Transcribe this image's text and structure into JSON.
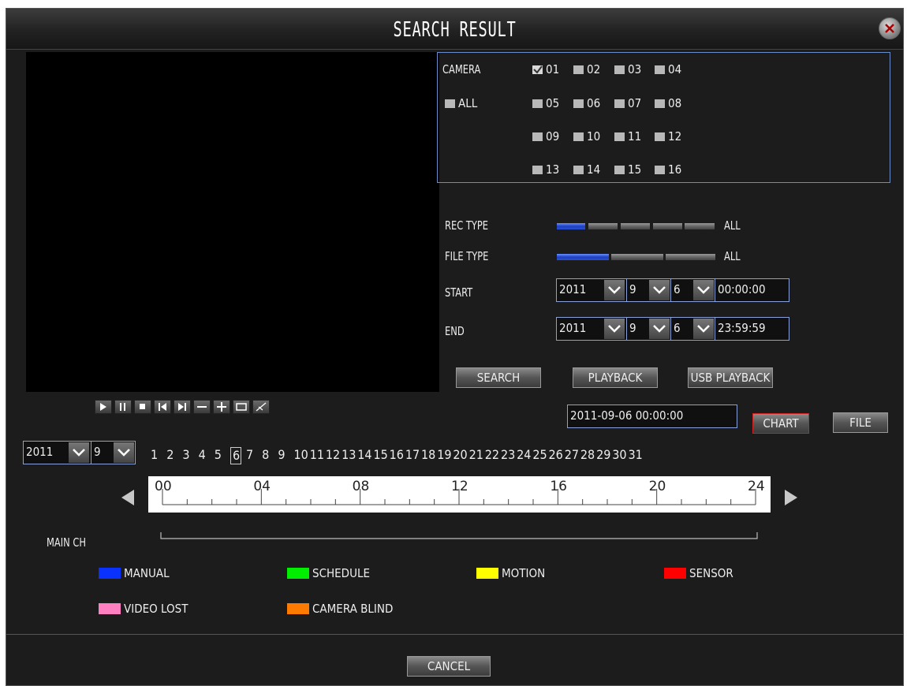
{
  "title": "SEARCH RESULT",
  "player_controls": [
    "play-icon",
    "pause-icon",
    "stop-icon",
    "prev-icon",
    "next-icon",
    "minus-icon",
    "plus-icon",
    "fullscreen-icon",
    "clip-icon"
  ],
  "camera": {
    "label": "CAMERA",
    "all_label": "ALL",
    "channels": [
      "01",
      "02",
      "03",
      "04",
      "05",
      "06",
      "07",
      "08",
      "09",
      "10",
      "11",
      "12",
      "13",
      "14",
      "15",
      "16"
    ],
    "checked": [
      "01"
    ]
  },
  "rec_type": {
    "label": "REC TYPE",
    "value": "ALL"
  },
  "file_type": {
    "label": "FILE TYPE",
    "value": "ALL"
  },
  "start": {
    "label": "START",
    "year": "2011",
    "month": "9",
    "day": "6",
    "time": "00:00:00"
  },
  "end": {
    "label": "END",
    "year": "2011",
    "month": "9",
    "day": "6",
    "time": "23:59:59"
  },
  "buttons": {
    "search": "SEARCH",
    "playback": "PLAYBACK",
    "usb_playback": "USB PLAYBACK",
    "chart": "CHART",
    "file": "FILE",
    "cancel": "CANCEL"
  },
  "current_time": "2011-09-06  00:00:00",
  "calendar": {
    "year": "2011",
    "month": "9",
    "selected_day": "6",
    "days": [
      "1",
      "2",
      "3",
      "4",
      "5",
      "6",
      "7",
      "8",
      "9",
      "10",
      "11",
      "12",
      "13",
      "14",
      "15",
      "16",
      "17",
      "18",
      "19",
      "20",
      "21",
      "22",
      "23",
      "24",
      "25",
      "26",
      "27",
      "28",
      "29",
      "30",
      "31"
    ]
  },
  "timeline": {
    "hour_labels": [
      "00",
      "04",
      "08",
      "12",
      "16",
      "20",
      "24"
    ]
  },
  "main_ch_label": "MAIN CH",
  "legend": [
    {
      "label": "MANUAL",
      "color": "#0a32ff"
    },
    {
      "label": "SCHEDULE",
      "color": "#00ee00"
    },
    {
      "label": "MOTION",
      "color": "#ffff00"
    },
    {
      "label": "SENSOR",
      "color": "#ff0000"
    },
    {
      "label": "VIDEO LOST",
      "color": "#ff80c0"
    },
    {
      "label": "CAMERA BLIND",
      "color": "#ff7a00"
    }
  ]
}
